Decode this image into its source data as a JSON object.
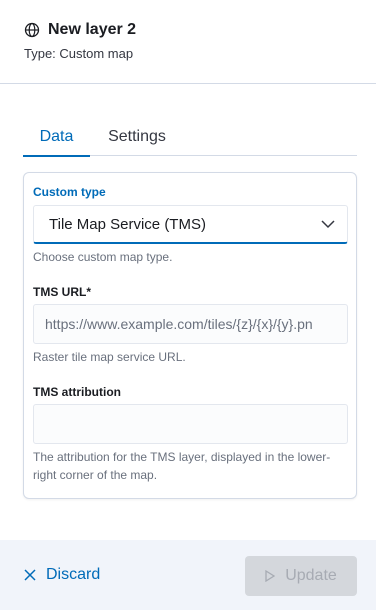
{
  "header": {
    "title": "New layer 2",
    "subtitle": "Type: Custom map",
    "icon": "globe-icon"
  },
  "tabs": [
    {
      "label": "Data",
      "selected": true
    },
    {
      "label": "Settings",
      "selected": false
    }
  ],
  "form": {
    "custom_type": {
      "label": "Custom type",
      "value": "Tile Map Service (TMS)",
      "help": "Choose custom map type."
    },
    "tms_url": {
      "label": "TMS URL",
      "required_mark": "*",
      "placeholder": "https://www.example.com/tiles/{z}/{x}/{y}.pn",
      "help": "Raster tile map service URL."
    },
    "tms_attribution": {
      "label": "TMS attribution",
      "value": "",
      "help_line1": "The attribution for the TMS layer, displayed in the lower-",
      "help_line2": "right corner of the map."
    }
  },
  "footer": {
    "discard_label": "Discard",
    "update_label": "Update"
  },
  "colors": {
    "accent": "#006bb8",
    "footer_bg": "#f1f4fa",
    "disabled_button": "#d4d7dc"
  }
}
